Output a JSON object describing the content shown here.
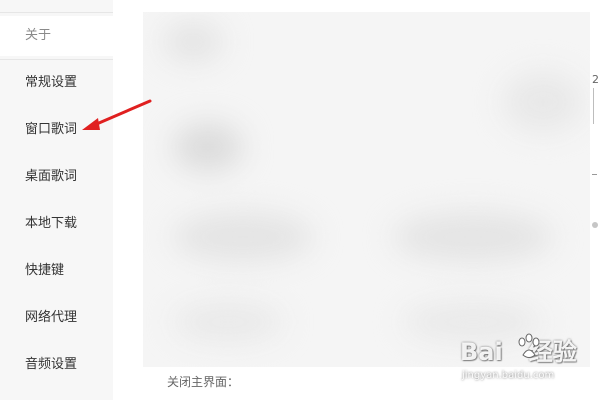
{
  "sidebar": {
    "items": [
      {
        "label": "关于"
      },
      {
        "label": "常规设置"
      },
      {
        "label": "窗口歌词"
      },
      {
        "label": "桌面歌词"
      },
      {
        "label": "本地下载"
      },
      {
        "label": "快捷键"
      },
      {
        "label": "网络代理"
      },
      {
        "label": "音频设置"
      }
    ]
  },
  "main": {
    "edge_text": "2",
    "bottom_label": "关闭主界面："
  },
  "annotation": {
    "arrow_color": "#e02020",
    "points_to": "窗口歌词"
  },
  "watermark": {
    "logo_left": "Bai",
    "logo_right": "经验",
    "url": "jingyan.baidu.com",
    "paw_icon": "baidu-paw-icon"
  },
  "colors": {
    "sidebar_bg": "#f7f7f7",
    "text": "#333333",
    "muted_text": "#8a8a8a"
  }
}
